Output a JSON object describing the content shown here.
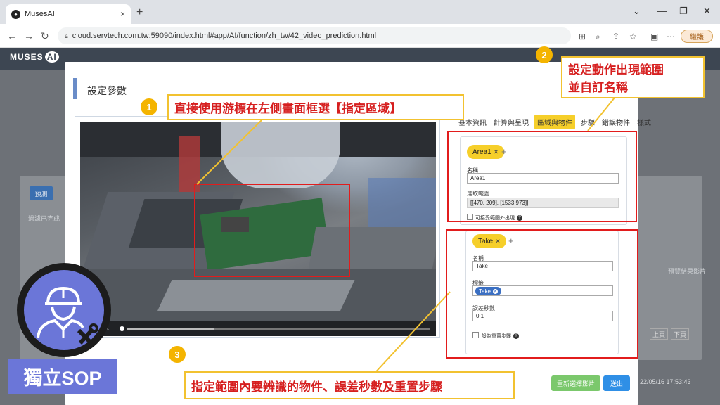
{
  "browser": {
    "tab_title": "MusesAI",
    "tab_close": "×",
    "new_tab": "+",
    "url": "cloud.servtech.com.tw:59090/index.html#app/AI/function/zh_tw/42_video_prediction.html",
    "login_label": "繼護"
  },
  "app": {
    "logo_text": "MUSES",
    "logo_ai": "AI",
    "bg_preview_label": "預測",
    "bg_text_left": "過濾已完成",
    "bg_text_right": "預覽結果影片",
    "bg_prev_page": "上頁",
    "bg_next_page": "下頁",
    "bg_timestamp": "22/05/16 17:53:43"
  },
  "modal": {
    "title": "設定參數",
    "tabs": [
      "基本資訊",
      "計算與呈現",
      "區域與物件",
      "步驟",
      "錯誤物件",
      "樣式"
    ],
    "active_tab_index": 2,
    "area": {
      "pill_label": "Area1",
      "name_label": "名稱",
      "name_value": "Area1",
      "range_label": "選取範圍",
      "range_value": "[[470,  209],  [1533,973]]",
      "checkbox_label": "可接受範圍外出現"
    },
    "action": {
      "pill_label": "Take",
      "name_label": "名稱",
      "name_value": "Take",
      "tag_label": "標籤",
      "tag_value": "Take",
      "error_sec_label": "誤差秒數",
      "error_sec_value": "0.1",
      "checkbox_label": "設為重置步驟"
    },
    "reselect_button": "重新選擇影片",
    "submit_button": "送出"
  },
  "annotations": {
    "step1_num": "1",
    "step1_text": "直接使用游標在左側畫面框選【指定區域】",
    "step2_num": "2",
    "step2_text_line1": "設定動作出現範圍",
    "step2_text_line2": "並自訂名稱",
    "step3_num": "3",
    "step3_text": "指定範圍內要辨識的物件、誤差秒數及重置步驟"
  },
  "sop_label": "獨立SOP",
  "colors": {
    "accent_yellow": "#f6cf2a",
    "annotation_red": "#e21c1c",
    "badge_orange": "#f4b400",
    "sop_purple": "#6b76d8",
    "primary_blue": "#2f8fe6",
    "green": "#7bc86c"
  }
}
